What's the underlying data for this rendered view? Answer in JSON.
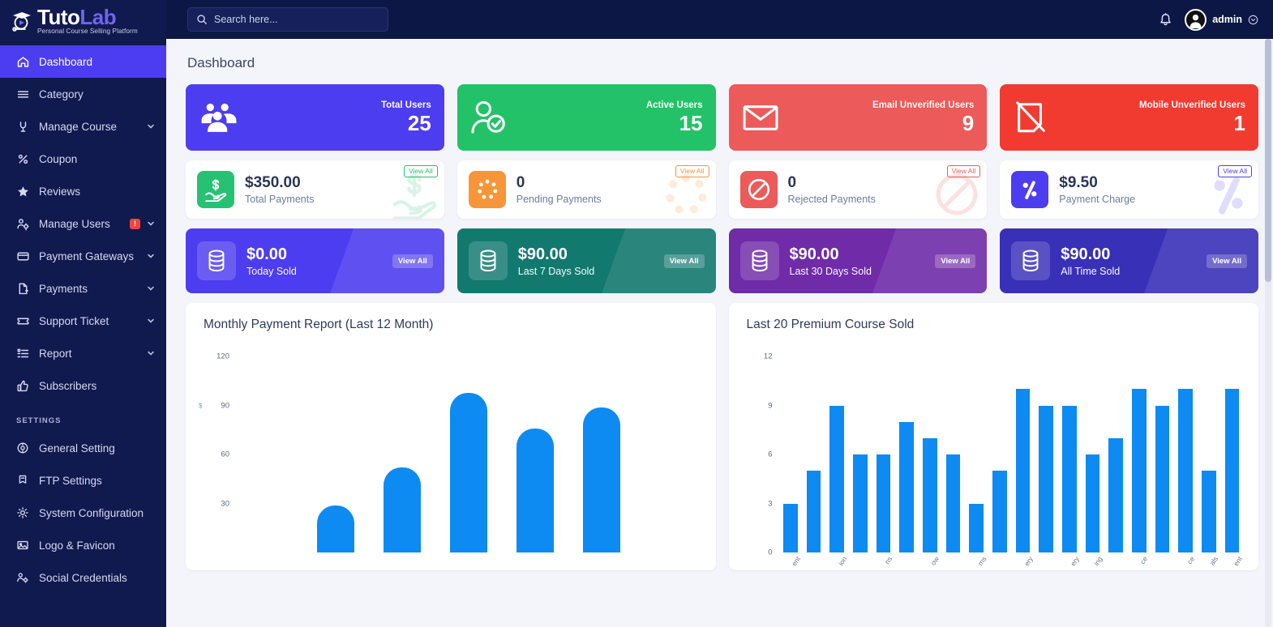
{
  "brand": {
    "name_part1": "Tuto",
    "name_part2": "Lab",
    "tagline": "Personal Course Selling Platform",
    "logo_icon": "graduation-cap-play-icon"
  },
  "topbar": {
    "search_placeholder": "Search here...",
    "search_value": "",
    "search_icon": "search-icon",
    "bell_icon": "bell-icon",
    "user_name": "admin",
    "user_chevron_icon": "chevron-down-circle-icon",
    "avatar_icon": "user-avatar-icon"
  },
  "sidebar": {
    "items": [
      {
        "label": "Dashboard",
        "icon": "home-icon",
        "active": true,
        "chevron": false,
        "badge": null
      },
      {
        "label": "Category",
        "icon": "menu-lines-icon",
        "active": false,
        "chevron": false,
        "badge": null
      },
      {
        "label": "Manage Course",
        "icon": "award-icon",
        "active": false,
        "chevron": true,
        "badge": null
      },
      {
        "label": "Coupon",
        "icon": "percent-icon",
        "active": false,
        "chevron": false,
        "badge": null
      },
      {
        "label": "Reviews",
        "icon": "star-icon",
        "active": false,
        "chevron": false,
        "badge": null
      },
      {
        "label": "Manage Users",
        "icon": "users-gear-icon",
        "active": false,
        "chevron": true,
        "badge": "!"
      },
      {
        "label": "Payment Gateways",
        "icon": "credit-card-icon",
        "active": false,
        "chevron": true,
        "badge": null
      },
      {
        "label": "Payments",
        "icon": "file-dollar-icon",
        "active": false,
        "chevron": true,
        "badge": null
      },
      {
        "label": "Support Ticket",
        "icon": "ticket-icon",
        "active": false,
        "chevron": true,
        "badge": null
      },
      {
        "label": "Report",
        "icon": "list-report-icon",
        "active": false,
        "chevron": true,
        "badge": null
      },
      {
        "label": "Subscribers",
        "icon": "thumbs-up-icon",
        "active": false,
        "chevron": false,
        "badge": null
      }
    ],
    "settings_heading": "SETTINGS",
    "settings_items": [
      {
        "label": "General Setting",
        "icon": "settings-disc-icon"
      },
      {
        "label": "FTP Settings",
        "icon": "flag-file-icon"
      },
      {
        "label": "System Configuration",
        "icon": "gear-icon"
      },
      {
        "label": "Logo & Favicon",
        "icon": "image-icon"
      },
      {
        "label": "Social Credentials",
        "icon": "users-cog-icon"
      }
    ]
  },
  "page": {
    "title": "Dashboard"
  },
  "stat_cards": [
    {
      "label": "Total Users",
      "value": "25",
      "color": "#4d3df0",
      "icon": "users-group-icon"
    },
    {
      "label": "Active Users",
      "value": "15",
      "color": "#23c268",
      "icon": "user-check-icon"
    },
    {
      "label": "Email Unverified Users",
      "value": "9",
      "color": "#ec5a5a",
      "icon": "envelope-icon"
    },
    {
      "label": "Mobile Unverified Users",
      "value": "1",
      "color": "#f23b30",
      "icon": "mobile-slash-icon"
    }
  ],
  "payment_cards": [
    {
      "value": "$350.00",
      "label": "Total Payments",
      "sq_color": "#27c173",
      "pill_color": "#27c173",
      "view_label": "View All",
      "icon": "hand-dollar-icon"
    },
    {
      "value": "0",
      "label": "Pending Payments",
      "sq_color": "#f79638",
      "pill_color": "#f79638",
      "view_label": "View All",
      "icon": "spinner-dots-icon"
    },
    {
      "value": "0",
      "label": "Rejected Payments",
      "sq_color": "#ec5a5a",
      "pill_color": "#ec5a5a",
      "view_label": "View All",
      "icon": "ban-icon"
    },
    {
      "value": "$9.50",
      "label": "Payment Charge",
      "sq_color": "#4d3df0",
      "pill_color": "#4d3df0",
      "view_label": "View All",
      "icon": "percent-box-icon"
    }
  ],
  "sold_cards": [
    {
      "value": "$0.00",
      "label": "Today Sold",
      "color": "#4d3df0",
      "view_label": "View All",
      "icon": "coin-stack-icon"
    },
    {
      "value": "$90.00",
      "label": "Last 7 Days Sold",
      "color": "#12796f",
      "view_label": "View All",
      "icon": "coin-stack-icon"
    },
    {
      "value": "$90.00",
      "label": "Last 30 Days Sold",
      "color": "#6f2ba8",
      "view_label": "View All",
      "icon": "coin-stack-icon"
    },
    {
      "value": "$90.00",
      "label": "All Time Sold",
      "color": "#3930b8",
      "view_label": "View All",
      "icon": "coin-stack-icon"
    }
  ],
  "chart_data": [
    {
      "id": "monthly-payment-report",
      "type": "bar",
      "title": "Monthly Payment Report (Last 12 Month)",
      "xlabel": "",
      "ylabel": "$",
      "ylim": [
        0,
        130
      ],
      "yticks": [
        30,
        60,
        90,
        120
      ],
      "grid": false,
      "bar_color": "#0d8bf2",
      "categories": [
        "",
        "",
        "",
        "",
        "",
        "",
        ""
      ],
      "values": [
        0,
        29,
        52,
        98,
        76,
        89,
        0
      ]
    },
    {
      "id": "last-20-premium-course-sold",
      "type": "bar",
      "title": "Last 20 Premium Course Sold",
      "xlabel": "",
      "ylabel": "",
      "ylim": [
        0,
        13
      ],
      "yticks": [
        0,
        3,
        6,
        9,
        12
      ],
      "grid": false,
      "bar_color": "#0d8bf2",
      "categories": [
        "ent",
        "",
        "ion",
        "",
        "ns",
        "",
        "ow",
        "",
        "ms",
        "",
        "ery",
        "",
        "ery",
        "ing",
        "",
        "ce",
        "",
        "ce",
        "als",
        "ent"
      ],
      "values": [
        3,
        5,
        9,
        6,
        6,
        8,
        7,
        6,
        3,
        5,
        10,
        9,
        9,
        6,
        7,
        10,
        9,
        10,
        5,
        10
      ]
    }
  ]
}
